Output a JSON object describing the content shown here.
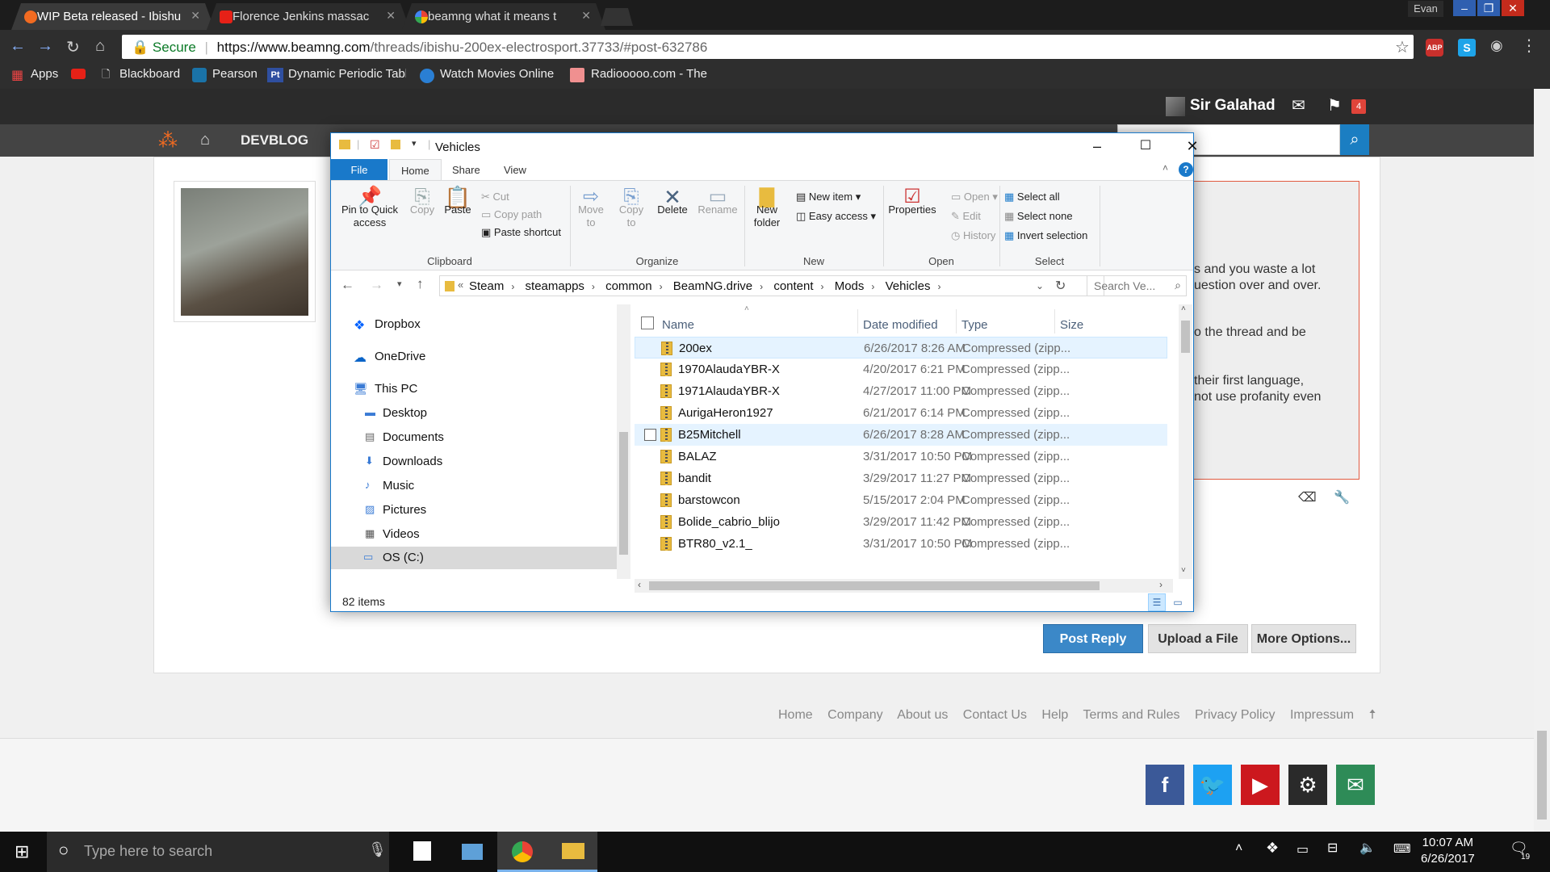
{
  "browser": {
    "tabs": [
      {
        "title": "WIP Beta released - Ibishu",
        "favicon_color": "#f26b21"
      },
      {
        "title": "Florence Jenkins massac",
        "favicon_color": "#e62117"
      },
      {
        "title": "beamng what it means t",
        "favicon_color": "#4285f4"
      }
    ],
    "profile_name": "Evan",
    "address": {
      "secure_label": "Secure",
      "url_host": "https://www.beamng.com",
      "url_path": "/threads/ibishu-200ex-electrosport.37733/#post-632786"
    },
    "extension_badge": "ABP",
    "bookmarks": [
      "Apps",
      "Blackboard",
      "Pearson",
      "Dynamic Periodic Tabl",
      "Watch Movies Online",
      "Radiooooo.com - The"
    ]
  },
  "forum": {
    "nav_label": "DEVBLOG",
    "username": "Sir Galahad",
    "alert_count": "4",
    "rules_lines": [
      "s and you waste a lot",
      "uestion over and over.",
      "o the thread and be",
      "their first language,",
      "not use profanity even"
    ],
    "buttons": {
      "post_reply": "Post Reply",
      "upload": "Upload a File",
      "more": "More Options..."
    },
    "footer_links": [
      "Home",
      "Company",
      "About us",
      "Contact Us",
      "Help",
      "Terms and Rules",
      "Privacy Policy",
      "Impressum"
    ],
    "social_colors": {
      "facebook": "#3b5998",
      "twitter": "#1da1f2",
      "youtube": "#cc181e",
      "steam": "#2a2a2a",
      "mail": "#2e8b57"
    }
  },
  "explorer": {
    "title": "Vehicles",
    "ribbon_tabs": [
      "File",
      "Home",
      "Share",
      "View"
    ],
    "clipboard": {
      "pin": "Pin to Quick access",
      "copy": "Copy",
      "paste": "Paste",
      "cut": "Cut",
      "copy_path": "Copy path",
      "paste_shortcut": "Paste shortcut",
      "group": "Clipboard"
    },
    "organize": {
      "move_to": "Move to",
      "copy_to": "Copy to",
      "delete": "Delete",
      "rename": "Rename",
      "group": "Organize"
    },
    "new": {
      "new_folder": "New folder",
      "new_item": "New item",
      "easy_access": "Easy access",
      "group": "New"
    },
    "open": {
      "properties": "Properties",
      "open": "Open",
      "edit": "Edit",
      "history": "History",
      "group": "Open"
    },
    "select": {
      "select_all": "Select all",
      "select_none": "Select none",
      "invert": "Invert selection",
      "group": "Select"
    },
    "breadcrumb": [
      "Steam",
      "steamapps",
      "common",
      "BeamNG.drive",
      "content",
      "Mods",
      "Vehicles"
    ],
    "search_placeholder": "Search Ve...",
    "nav_items": [
      "Dropbox",
      "OneDrive",
      "This PC",
      "Desktop",
      "Documents",
      "Downloads",
      "Music",
      "Pictures",
      "Videos",
      "OS (C:)"
    ],
    "columns": [
      "Name",
      "Date modified",
      "Type",
      "Size"
    ],
    "files": [
      {
        "name": "200ex",
        "date": "6/26/2017 8:26 AM",
        "type": "Compressed (zipp..."
      },
      {
        "name": "1970AlaudaYBR-X",
        "date": "4/20/2017 6:21 PM",
        "type": "Compressed (zipp..."
      },
      {
        "name": "1971AlaudaYBR-X",
        "date": "4/27/2017 11:00 PM",
        "type": "Compressed (zipp..."
      },
      {
        "name": "AurigaHeron1927",
        "date": "6/21/2017 6:14 PM",
        "type": "Compressed (zipp..."
      },
      {
        "name": "B25Mitchell",
        "date": "6/26/2017 8:28 AM",
        "type": "Compressed (zipp..."
      },
      {
        "name": "BALAZ",
        "date": "3/31/2017 10:50 PM",
        "type": "Compressed (zipp..."
      },
      {
        "name": "bandit",
        "date": "3/29/2017 11:27 PM",
        "type": "Compressed (zipp..."
      },
      {
        "name": "barstowcon",
        "date": "5/15/2017 2:04 PM",
        "type": "Compressed (zipp..."
      },
      {
        "name": "Bolide_cabrio_blijo",
        "date": "3/29/2017 11:42 PM",
        "type": "Compressed (zipp..."
      },
      {
        "name": "BTR80_v2.1_",
        "date": "3/31/2017 10:50 PM",
        "type": "Compressed (zipp..."
      }
    ],
    "item_count": "82 items"
  },
  "taskbar": {
    "search_placeholder": "Type here to search",
    "time": "10:07 AM",
    "date": "6/26/2017",
    "notification_count": "19"
  }
}
